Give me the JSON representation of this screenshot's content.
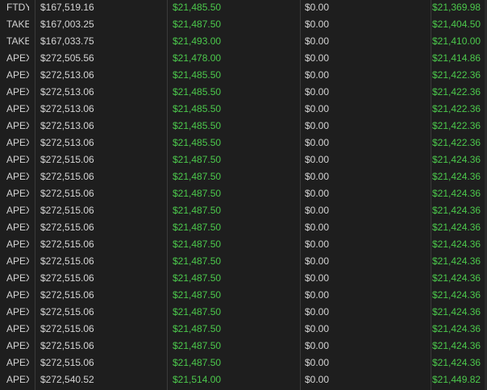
{
  "table": {
    "rows": [
      {
        "name": "FTDY",
        "balance": "$167,519.16",
        "equity": "$21,485.50",
        "fees": "$0.00",
        "net": "$21,369.98"
      },
      {
        "name": "TAKEI",
        "balance": "$167,003.25",
        "equity": "$21,487.50",
        "fees": "$0.00",
        "net": "$21,404.50"
      },
      {
        "name": "TAKEI",
        "balance": "$167,033.75",
        "equity": "$21,493.00",
        "fees": "$0.00",
        "net": "$21,410.00"
      },
      {
        "name": "APEX",
        "balance": "$272,505.56",
        "equity": "$21,478.00",
        "fees": "$0.00",
        "net": "$21,414.86"
      },
      {
        "name": "APEX",
        "balance": "$272,513.06",
        "equity": "$21,485.50",
        "fees": "$0.00",
        "net": "$21,422.36"
      },
      {
        "name": "APEX",
        "balance": "$272,513.06",
        "equity": "$21,485.50",
        "fees": "$0.00",
        "net": "$21,422.36"
      },
      {
        "name": "APEX",
        "balance": "$272,513.06",
        "equity": "$21,485.50",
        "fees": "$0.00",
        "net": "$21,422.36"
      },
      {
        "name": "APEX",
        "balance": "$272,513.06",
        "equity": "$21,485.50",
        "fees": "$0.00",
        "net": "$21,422.36"
      },
      {
        "name": "APEX",
        "balance": "$272,513.06",
        "equity": "$21,485.50",
        "fees": "$0.00",
        "net": "$21,422.36"
      },
      {
        "name": "APEX",
        "balance": "$272,515.06",
        "equity": "$21,487.50",
        "fees": "$0.00",
        "net": "$21,424.36"
      },
      {
        "name": "APEX",
        "balance": "$272,515.06",
        "equity": "$21,487.50",
        "fees": "$0.00",
        "net": "$21,424.36"
      },
      {
        "name": "APEX",
        "balance": "$272,515.06",
        "equity": "$21,487.50",
        "fees": "$0.00",
        "net": "$21,424.36"
      },
      {
        "name": "APEX",
        "balance": "$272,515.06",
        "equity": "$21,487.50",
        "fees": "$0.00",
        "net": "$21,424.36"
      },
      {
        "name": "APEX",
        "balance": "$272,515.06",
        "equity": "$21,487.50",
        "fees": "$0.00",
        "net": "$21,424.36"
      },
      {
        "name": "APEX",
        "balance": "$272,515.06",
        "equity": "$21,487.50",
        "fees": "$0.00",
        "net": "$21,424.36"
      },
      {
        "name": "APEX",
        "balance": "$272,515.06",
        "equity": "$21,487.50",
        "fees": "$0.00",
        "net": "$21,424.36"
      },
      {
        "name": "APEX",
        "balance": "$272,515.06",
        "equity": "$21,487.50",
        "fees": "$0.00",
        "net": "$21,424.36"
      },
      {
        "name": "APEX",
        "balance": "$272,515.06",
        "equity": "$21,487.50",
        "fees": "$0.00",
        "net": "$21,424.36"
      },
      {
        "name": "APEX",
        "balance": "$272,515.06",
        "equity": "$21,487.50",
        "fees": "$0.00",
        "net": "$21,424.36"
      },
      {
        "name": "APEX",
        "balance": "$272,515.06",
        "equity": "$21,487.50",
        "fees": "$0.00",
        "net": "$21,424.36"
      },
      {
        "name": "APEX",
        "balance": "$272,515.06",
        "equity": "$21,487.50",
        "fees": "$0.00",
        "net": "$21,424.36"
      },
      {
        "name": "APEX",
        "balance": "$272,515.06",
        "equity": "$21,487.50",
        "fees": "$0.00",
        "net": "$21,424.36"
      },
      {
        "name": "APEX",
        "balance": "$272,540.52",
        "equity": "$21,514.00",
        "fees": "$0.00",
        "net": "$21,449.82"
      }
    ]
  },
  "colors": {
    "background": "#1e1e1e",
    "text": "#d4d4d4",
    "positive": "#4cc94c",
    "divider": "#3a3a3a"
  }
}
